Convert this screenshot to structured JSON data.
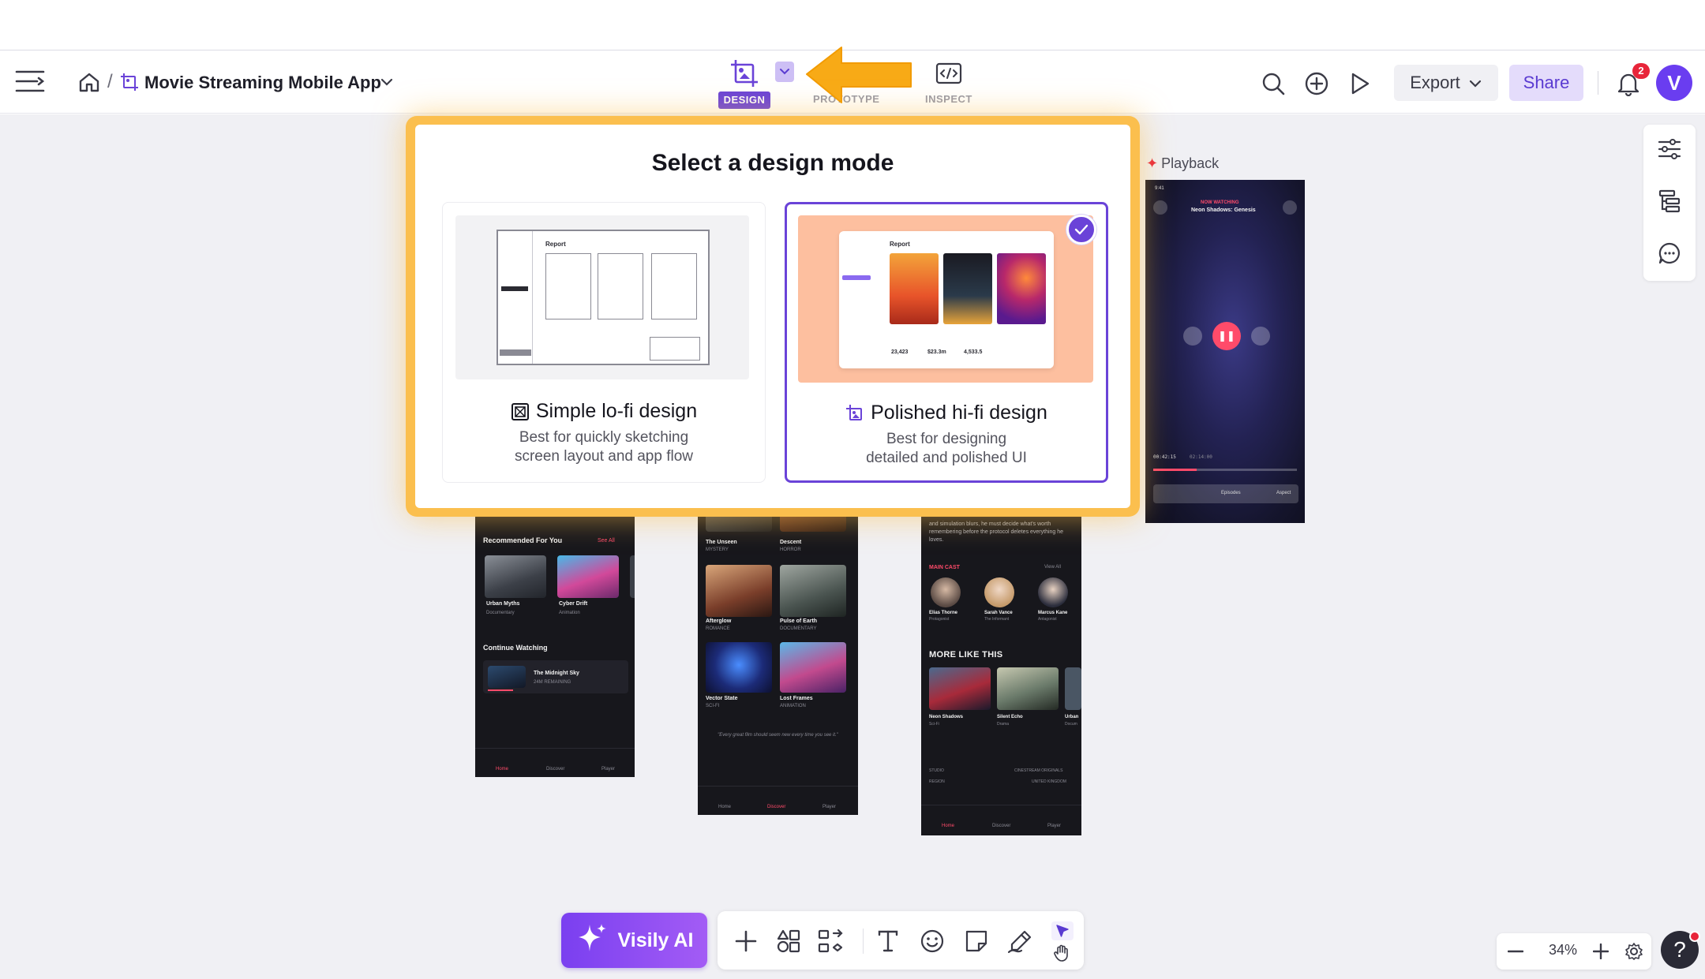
{
  "header": {
    "project_title": "Movie Streaming Mobile App",
    "breadcrumb_separator": "/",
    "modes": {
      "design": "DESIGN",
      "prototype": "PROTOTYPE",
      "inspect": "INSPECT"
    },
    "export_label": "Export",
    "share_label": "Share",
    "notification_count": "2",
    "avatar_initial": "V"
  },
  "modal": {
    "title": "Select a design mode",
    "options": [
      {
        "title": "Simple lo-fi design",
        "desc_line1": "Best for quickly sketching",
        "desc_line2": "screen layout and app flow",
        "preview_heading": "Report"
      },
      {
        "title": "Polished hi-fi design",
        "desc_line1": "Best for designing",
        "desc_line2": "detailed and polished UI",
        "preview_heading": "Report",
        "preview_stats": [
          "23,423",
          "$23.3m",
          "4,533.5"
        ],
        "selected": true
      }
    ]
  },
  "canvas": {
    "playback_label": "Playback",
    "screen1": {
      "section1": "Recommended For You",
      "see_all": "See All",
      "cards": [
        {
          "title": "Urban Myths",
          "tag": "Documentary"
        },
        {
          "title": "Cyber Drift",
          "tag": "Animation"
        }
      ],
      "section2": "Continue Watching",
      "continue_title": "The Midnight Sky",
      "continue_sub": "24M REMAINING",
      "nav": [
        "Home",
        "Discover",
        "Player"
      ]
    },
    "screen2": {
      "items": [
        {
          "title": "The Unseen",
          "tag": "MYSTERY"
        },
        {
          "title": "Descent",
          "tag": "HORROR"
        },
        {
          "title": "Afterglow",
          "tag": "ROMANCE"
        },
        {
          "title": "Pulse of Earth",
          "tag": "DOCUMENTARY"
        },
        {
          "title": "Vector State",
          "tag": "SCI-FI"
        },
        {
          "title": "Lost Frames",
          "tag": "ANIMATION"
        }
      ],
      "quote": "\"Every great film should seem new every time you see it.\"",
      "nav": [
        "Home",
        "Discover",
        "Player"
      ]
    },
    "screen3": {
      "synopsis": "and simulation blurs, he must decide what's worth remembering before the protocol deletes everything he loves.",
      "main_cast": "MAIN CAST",
      "view_all": "View All",
      "cast": [
        {
          "name": "Elias Thorne",
          "role": "Protagonist"
        },
        {
          "name": "Sarah Vance",
          "role": "The Informant"
        },
        {
          "name": "Marcus Kane",
          "role": "Antagonist"
        }
      ],
      "more_like_this": "MORE LIKE THIS",
      "more": [
        {
          "title": "Neon Shadows",
          "tag": "Sci-Fi"
        },
        {
          "title": "Silent Echo",
          "tag": "Drama"
        },
        {
          "title": "Urban",
          "tag": "Docum"
        }
      ],
      "footer": [
        {
          "label": "STUDIO",
          "value": "CINESTREAM ORIGINALS"
        },
        {
          "label": "REGION",
          "value": "UNITED KINGDOM"
        }
      ],
      "nav": [
        "Home",
        "Discover",
        "Player"
      ]
    },
    "screen4": {
      "time": "9:41",
      "now_watching": "NOW WATCHING",
      "title": "Neon Shadows: Genesis",
      "elapsed": "00:42:15",
      "total": "02:14:00",
      "episodes": "Episodes",
      "aspect": "Aspect",
      "progress": 0.3
    }
  },
  "toolbar": {
    "ai_label": "Visily AI"
  },
  "zoom": {
    "value": "34%"
  },
  "help": {
    "label": "?"
  }
}
